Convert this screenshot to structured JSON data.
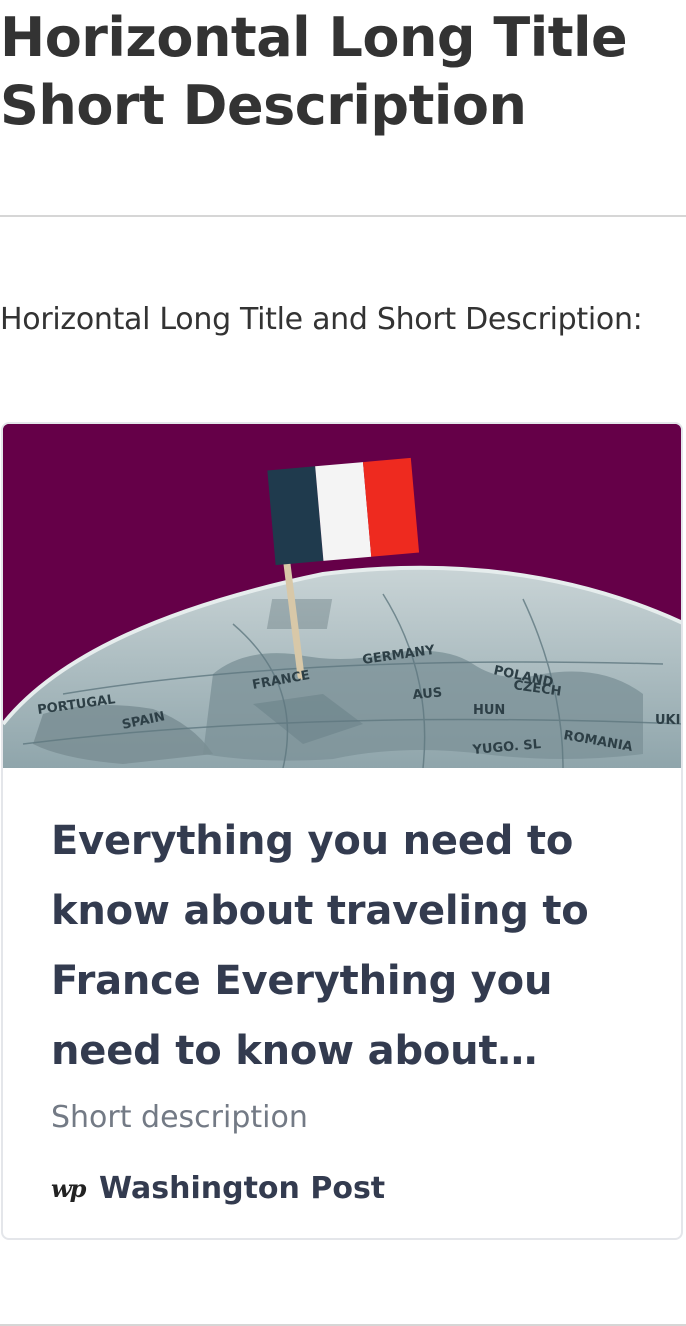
{
  "page": {
    "title_line1": "Horizontal Long Title",
    "title_line2": "Short Description",
    "section_label": "Horizontal Long Title and Short Description:"
  },
  "card": {
    "image_icon": "globe-with-french-flag-image",
    "image_labels": [
      "GERMANY",
      "POLAND",
      "FRANCE",
      "SPAIN",
      "AUS",
      "CZECH",
      "HUN",
      "ROMANIA",
      "YUGO. SL",
      "PORTUGAL",
      "UKI"
    ],
    "title_line1": "Everything you need to",
    "title_line2": "know about traveling to",
    "title_line3": "France Everything you",
    "title_line4": "need to know about…",
    "description": "Short description",
    "source_logo": "wp",
    "source_name": "Washington Post",
    "colors": {
      "image_background": "#650048",
      "title": "#333b4f",
      "description": "#737a85"
    }
  }
}
